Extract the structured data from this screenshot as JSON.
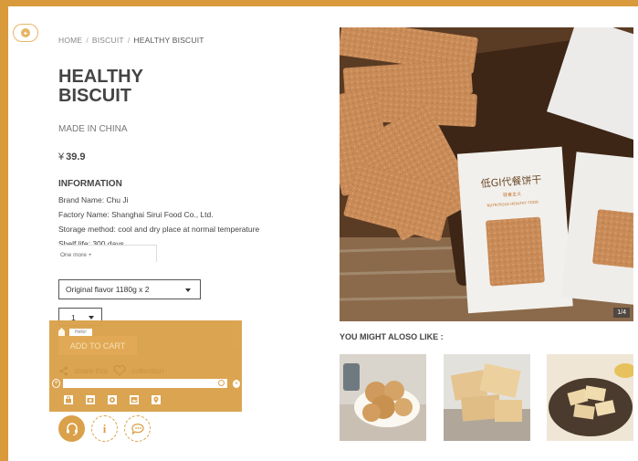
{
  "breadcrumb": {
    "home": "HOME",
    "category": "BISCUIT",
    "current": "HEALTHY BISCUIT"
  },
  "product": {
    "title_line1": "HEALTHY",
    "title_line2": "BISCUIT",
    "origin": "MADE IN CHINA",
    "currency": "¥",
    "price": "39.9"
  },
  "information": {
    "heading": "INFORMATION",
    "lines": [
      "Brand Name: Chu Ji",
      "Factory Name: Shanghai Sirui Food Co., Ltd.",
      "Storage method: cool and dry place at normal temperature",
      "Shelf life: 300 days"
    ],
    "more": "One more +"
  },
  "options": {
    "flavor_selected": "Original flavor 1180g x 2",
    "quantity_selected": "1"
  },
  "panel": {
    "greeting": "Hello!",
    "add_to_cart": "ADD TO CART",
    "share": "share this",
    "collection": "collection"
  },
  "gallery": {
    "counter": "1/4",
    "package_text_cn": "低GI代餐饼干",
    "package_sub_cn": "轻食主义",
    "package_text_en": "NUTRITIOUS HEALTHY FOOD"
  },
  "recommend": {
    "heading": "YOU MIGHT ALOSO LIKE :"
  },
  "colors": {
    "accent": "#d99a3c",
    "panel": "#daa14a"
  }
}
